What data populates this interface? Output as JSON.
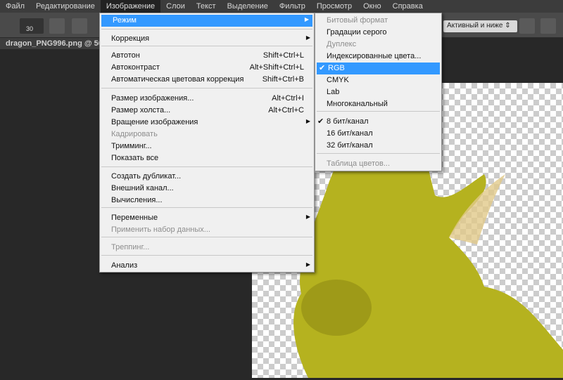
{
  "menubar": [
    "Файл",
    "Редактирование",
    "Изображение",
    "Слои",
    "Текст",
    "Выделение",
    "Фильтр",
    "Просмотр",
    "Окно",
    "Справка"
  ],
  "options": {
    "brush_size": "30",
    "blend_select": "Активный и ниже"
  },
  "document_tab": "dragon_PNG996.png @ 50%",
  "image_menu": [
    {
      "label": "Режим",
      "arrow": true,
      "hl": true
    },
    {
      "label": "Коррекция",
      "arrow": true
    },
    {
      "label": "Автотон",
      "shortcut": "Shift+Ctrl+L"
    },
    {
      "label": "Автоконтраст",
      "shortcut": "Alt+Shift+Ctrl+L"
    },
    {
      "label": "Автоматическая цветовая коррекция",
      "shortcut": "Shift+Ctrl+B"
    },
    {
      "label": "Размер изображения...",
      "shortcut": "Alt+Ctrl+I"
    },
    {
      "label": "Размер холста...",
      "shortcut": "Alt+Ctrl+C"
    },
    {
      "label": "Вращение изображения",
      "arrow": true
    },
    {
      "label": "Кадрировать",
      "disabled": true
    },
    {
      "label": "Тримминг..."
    },
    {
      "label": "Показать все"
    },
    {
      "label": "Создать дубликат..."
    },
    {
      "label": "Внешний канал..."
    },
    {
      "label": "Вычисления..."
    },
    {
      "label": "Переменные",
      "arrow": true
    },
    {
      "label": "Применить набор данных...",
      "disabled": true
    },
    {
      "label": "Треппинг...",
      "disabled": true
    },
    {
      "label": "Анализ",
      "arrow": true
    }
  ],
  "mode_submenu": [
    {
      "label": "Битовый формат",
      "disabled": true
    },
    {
      "label": "Градации серого"
    },
    {
      "label": "Дуплекс",
      "disabled": true
    },
    {
      "label": "Индексированные цвета..."
    },
    {
      "label": "RGB",
      "checked": true,
      "hl": true
    },
    {
      "label": "CMYK"
    },
    {
      "label": "Lab"
    },
    {
      "label": "Многоканальный"
    },
    {
      "label": "8 бит/канал",
      "checked": true
    },
    {
      "label": "16 бит/канал"
    },
    {
      "label": "32 бит/канал"
    },
    {
      "label": "Таблица цветов...",
      "disabled": true
    }
  ],
  "colors": {
    "highlight": "#3399ff",
    "dragon": "#c8c82a"
  }
}
